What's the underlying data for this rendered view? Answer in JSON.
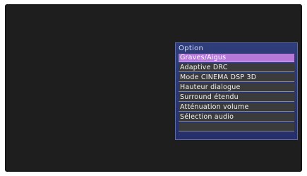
{
  "menu": {
    "title": "Option",
    "selected_index": 0,
    "items": [
      {
        "label": "Graves/Aigus"
      },
      {
        "label": "Adaptive DRC"
      },
      {
        "label": "Mode CINEMA DSP 3D"
      },
      {
        "label": "Hauteur dialogue"
      },
      {
        "label": "Surround étendu"
      },
      {
        "label": "Atténuation volume"
      },
      {
        "label": "Sélection audio"
      },
      {
        "label": ""
      }
    ]
  },
  "colors": {
    "screen_background": "#1e1e1e",
    "menu_background": "#2f3e7a",
    "item_background": "#3b3b3b",
    "selected_highlight": "#b57ad8"
  }
}
